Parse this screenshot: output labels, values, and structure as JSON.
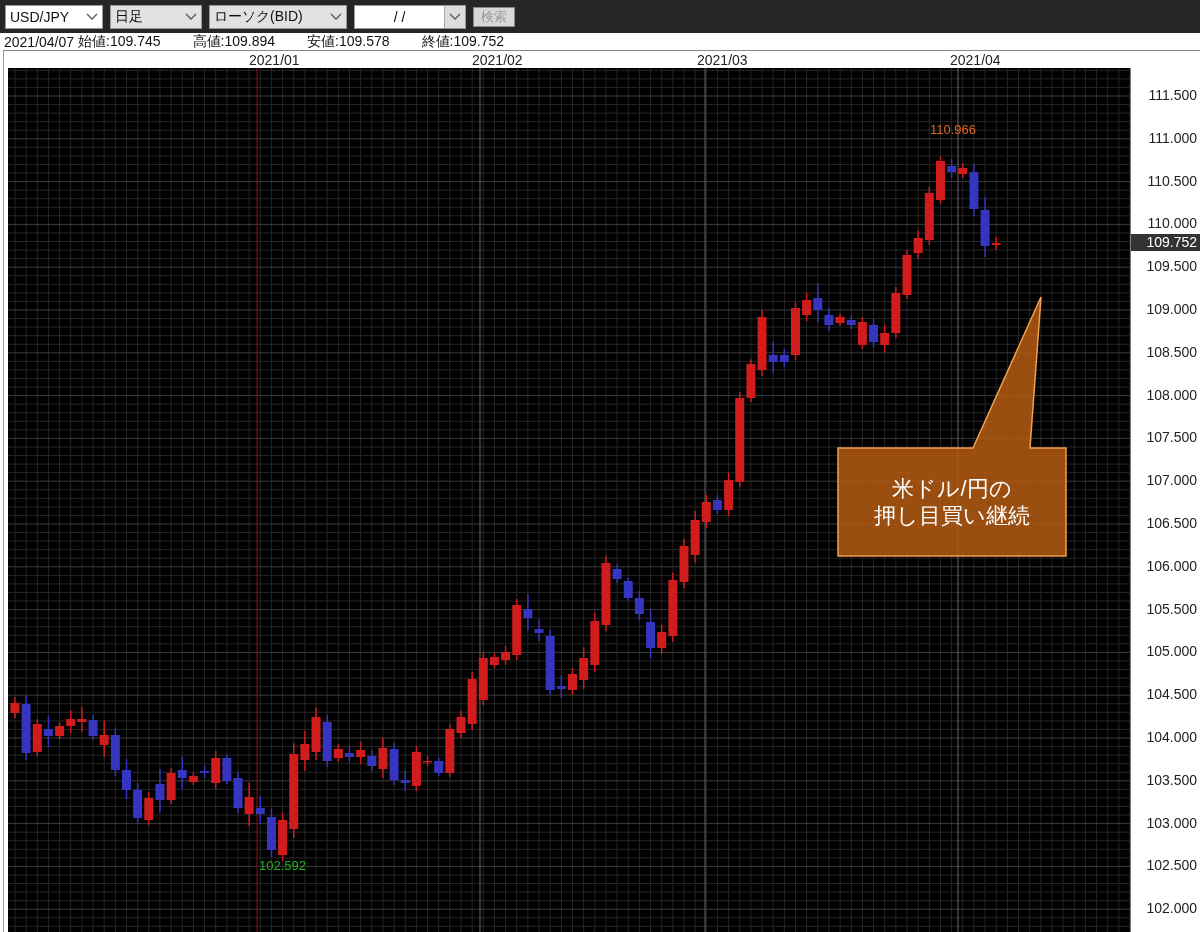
{
  "toolbar": {
    "symbol": "USD/JPY",
    "timeframe": "日足",
    "chart_type": "ローソク(BID)",
    "date": "/ /",
    "search_button": {
      "label": "検索",
      "disabled": true
    }
  },
  "info_line": {
    "date": "2021/04/07",
    "values": [
      "始値:109.745",
      "高値:109.894",
      "安値:109.578",
      "終値:109.752"
    ]
  },
  "chart": {
    "date_labels": [
      "2021/01",
      "2021/02",
      "2021/03",
      "2021/04"
    ],
    "price_labels": [
      "111.500",
      "111.000",
      "110.500",
      "110.000",
      "109.500",
      "109.000",
      "108.500",
      "108.000",
      "107.500",
      "107.000",
      "106.500",
      "106.000",
      "105.500",
      "105.000",
      "104.500",
      "104.000",
      "103.500",
      "103.000",
      "102.500",
      "102.000"
    ],
    "high_label": "110.966",
    "low_label": "102.592",
    "current_price": "109.752",
    "annotation": [
      "米ドル/円の",
      "押し目買い継続"
    ]
  }
}
